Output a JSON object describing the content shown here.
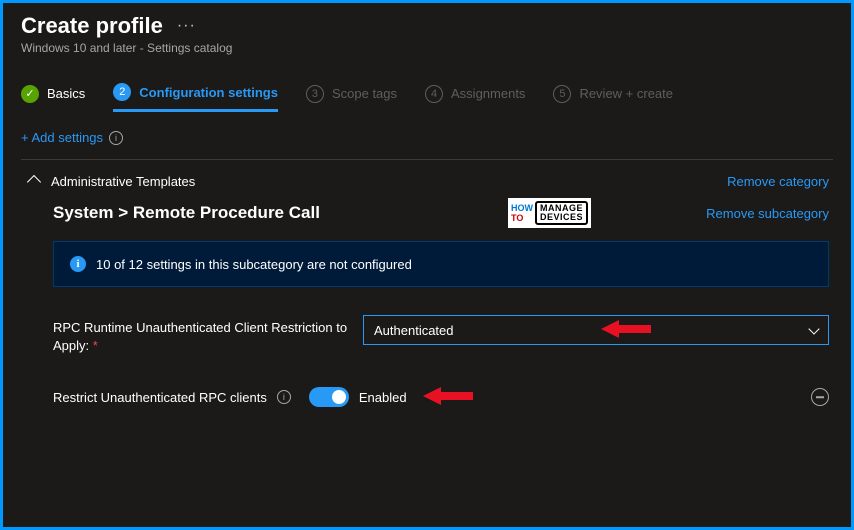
{
  "header": {
    "title": "Create profile",
    "subtitle": "Windows 10 and later - Settings catalog"
  },
  "steps": [
    {
      "num": "✓",
      "label": "Basics",
      "state": "done"
    },
    {
      "num": "2",
      "label": "Configuration settings",
      "state": "active"
    },
    {
      "num": "3",
      "label": "Scope tags",
      "state": "pending"
    },
    {
      "num": "4",
      "label": "Assignments",
      "state": "pending"
    },
    {
      "num": "5",
      "label": "Review + create",
      "state": "pending"
    }
  ],
  "add_settings_label": "+ Add settings",
  "category": {
    "name": "Administrative Templates",
    "remove_label": "Remove category"
  },
  "subcategory": {
    "breadcrumb": "System  >  Remote Procedure Call",
    "remove_label": "Remove subcategory"
  },
  "notice": "10 of 12 settings in this subcategory are not configured",
  "setting_select": {
    "label": "RPC Runtime Unauthenticated Client Restriction to Apply:",
    "value": "Authenticated"
  },
  "setting_toggle": {
    "label": "Restrict Unauthenticated RPC clients",
    "state_label": "Enabled"
  },
  "logo": {
    "how": "HOW",
    "to": "TO",
    "l1": "MANAGE",
    "l2": "DEVICES"
  }
}
